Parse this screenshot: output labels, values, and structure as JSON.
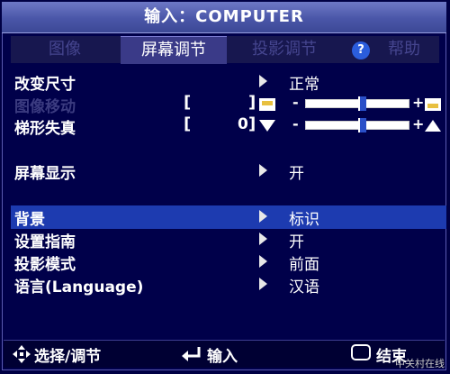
{
  "window": {
    "title": "输入：COMPUTER"
  },
  "tabs": [
    {
      "label": "图像",
      "active": false
    },
    {
      "label": "屏幕调节",
      "active": true
    },
    {
      "label": "投影调节",
      "active": false
    },
    {
      "label": "帮助",
      "active": false
    }
  ],
  "items": {
    "resize": {
      "label": "改变尺寸",
      "value": "正常"
    },
    "image_shift": {
      "label": "图像移动",
      "value": "",
      "disabled": true
    },
    "keystone": {
      "label": "梯形失真",
      "value": "0",
      "level": 0.55
    },
    "screen_display": {
      "label": "屏幕显示",
      "value": "开"
    },
    "background": {
      "label": "背景",
      "value": "标识",
      "selected": true
    },
    "setup_guide": {
      "label": "设置指南",
      "value": "开"
    },
    "projection_mode": {
      "label": "投影模式",
      "value": "前面"
    },
    "language": {
      "label": "语言(Language)",
      "value": "汉语"
    }
  },
  "image_shift_level": 0.55,
  "footer": {
    "navigate_label": "选择/调节",
    "enter_label": "输入",
    "menu_label": "结束"
  },
  "watermark": "中关村在线",
  "colors": {
    "accent": "#1d3bb0",
    "title_bar": "#4a56a8",
    "background": "#00004a"
  }
}
